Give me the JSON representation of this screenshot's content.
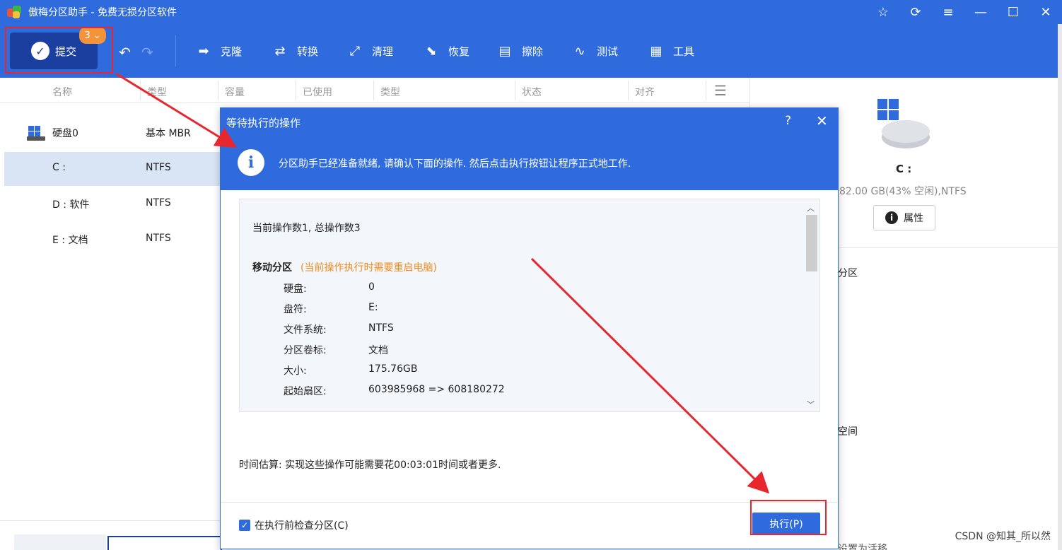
{
  "app": {
    "title": "傲梅分区助手 - 免费无损分区软件",
    "window_controls": [
      "star-icon",
      "refresh-icon",
      "menu-icon",
      "minimize-icon",
      "maximize-icon",
      "close-icon"
    ]
  },
  "toolbar": {
    "submit_label": "提交",
    "pending_count": "3",
    "tools": [
      {
        "label": "克隆",
        "icon": "clone-icon"
      },
      {
        "label": "转换",
        "icon": "convert-icon"
      },
      {
        "label": "清理",
        "icon": "clean-icon"
      },
      {
        "label": "恢复",
        "icon": "restore-icon"
      },
      {
        "label": "擦除",
        "icon": "wipe-icon"
      },
      {
        "label": "测试",
        "icon": "test-icon"
      },
      {
        "label": "工具",
        "icon": "tools-icon"
      }
    ]
  },
  "table": {
    "headers": [
      "名称",
      "类型",
      "容量",
      "已使用",
      "类型",
      "状态",
      "对齐"
    ],
    "rows": [
      {
        "name": "硬盘0",
        "type": "基本 MBR"
      },
      {
        "name": "C :",
        "type": "NTFS"
      },
      {
        "name": "D : 软件",
        "type": "NTFS"
      },
      {
        "name": "E : 文档",
        "type": "NTFS"
      }
    ]
  },
  "right_panel": {
    "drive_letter": "C :",
    "info": "82.00 GB(43% 空闲),NTFS",
    "properties_label": "属性",
    "item1": "分区",
    "item2": "空间",
    "item3": "设置为活移"
  },
  "dialog": {
    "title": "等待执行的操作",
    "banner": "分区助手已经准备就绪, 请确认下面的操作. 然后点击执行按钮让程序正式地工作.",
    "op_count": "当前操作数1, 总操作数3",
    "op_title": "移动分区",
    "op_warning": "(当前操作执行时需要重启电脑)",
    "details": [
      {
        "label": "硬盘:",
        "value": "0"
      },
      {
        "label": "盘符:",
        "value": "E:"
      },
      {
        "label": "文件系统:",
        "value": "NTFS"
      },
      {
        "label": "分区卷标:",
        "value": "文档"
      },
      {
        "label": "大小:",
        "value": "175.76GB"
      },
      {
        "label": "起始扇区:",
        "value": "603985968 => 608180272"
      }
    ],
    "time_estimate": "时间估算: 实现这些操作可能需要花00:03:01时间或者更多.",
    "check_label": "在执行前检查分区(C)",
    "execute_label": "执行(P)"
  },
  "watermark": "CSDN @知其_所以然",
  "colors": {
    "brand_blue": "#2f6bdd",
    "dark_blue": "#1b3f9f",
    "warning_orange": "#f28a1e",
    "annotation_red": "#e8262e"
  }
}
